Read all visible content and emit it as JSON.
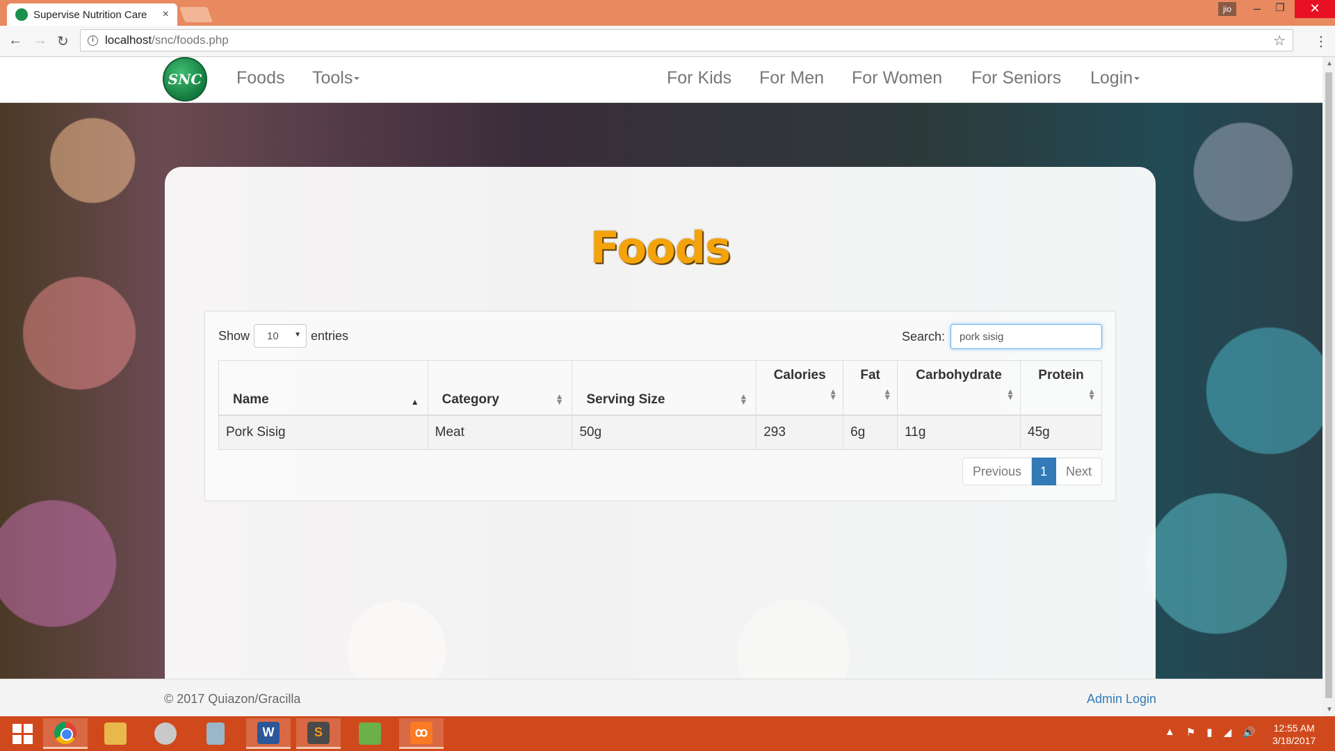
{
  "browser": {
    "tab_title": "Supervise Nutrition Care",
    "tab_close": "×",
    "url_host": "localhost",
    "url_path": "/snc/foods.php",
    "user_badge": "jio",
    "minimize": "–",
    "maximize": "❐",
    "close": "✕",
    "back": "←",
    "forward": "→",
    "reload": "↻",
    "bookmark_star": "☆",
    "menu": "⋮"
  },
  "nav": {
    "logo_text": "SNC",
    "foods": "Foods",
    "tools": "Tools",
    "for_kids": "For Kids",
    "for_men": "For Men",
    "for_women": "For Women",
    "for_seniors": "For Seniors",
    "login": "Login"
  },
  "page": {
    "title": "Foods"
  },
  "datatable": {
    "show_label": "Show",
    "entries_label": "entries",
    "page_length": "10",
    "search_label": "Search:",
    "search_value": "pork sisig",
    "columns": [
      "Name",
      "Category",
      "Serving Size",
      "Calories",
      "Fat",
      "Carbohydrate",
      "Protein"
    ],
    "rows": [
      [
        "Pork Sisig",
        "Meat",
        "50g",
        "293",
        "6g",
        "11g",
        "45g"
      ]
    ],
    "previous": "Previous",
    "current_page": "1",
    "next": "Next"
  },
  "footer": {
    "copyright": "©  2017 Quiazon/Gracilla",
    "admin_login": "Admin Login"
  },
  "taskbar": {
    "word_label": "W",
    "sublime_label": "S",
    "xampp_label": "ꝏ",
    "time": "12:55 AM",
    "date": "3/18/2017"
  }
}
